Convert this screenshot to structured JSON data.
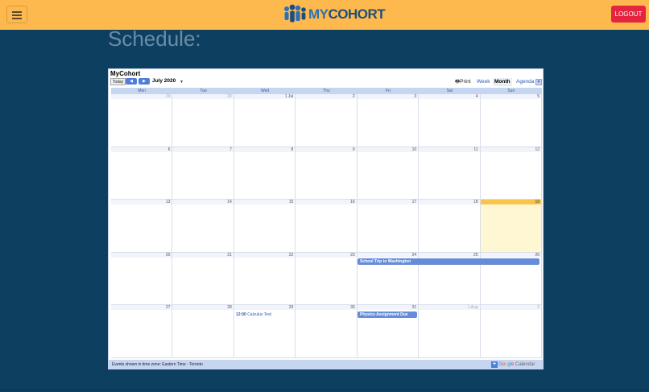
{
  "header": {
    "logo_my": "MY",
    "logo_cohort": "COHORT",
    "logout_label": "LOGOUT",
    "menu_icon": "hamburger-icon"
  },
  "page": {
    "title": "Schedule:"
  },
  "calendar": {
    "title": "MyCohort",
    "today_label": "Today",
    "prev_icon": "chevron-left-icon",
    "next_icon": "chevron-right-icon",
    "month_label": "July 2020",
    "dropdown_icon": "caret-down-icon",
    "print_label": "Print",
    "views": {
      "week": "Week",
      "month": "Month",
      "agenda": "Agenda"
    },
    "active_view": "Month",
    "weekdays": [
      "Mon",
      "Tue",
      "Wed",
      "Thu",
      "Fri",
      "Sat",
      "Sun"
    ],
    "weeks": [
      [
        "29",
        "30",
        "1 Jul",
        "2",
        "3",
        "4",
        "5"
      ],
      [
        "6",
        "7",
        "8",
        "9",
        "10",
        "11",
        "12"
      ],
      [
        "13",
        "14",
        "15",
        "16",
        "17",
        "18",
        "19"
      ],
      [
        "20",
        "21",
        "22",
        "23",
        "24",
        "25",
        "26"
      ],
      [
        "27",
        "28",
        "29",
        "30",
        "31",
        "1 Aug",
        "2"
      ]
    ],
    "today_date": "19",
    "events": {
      "school_trip": "School Trip to Washington",
      "calculus_time": "12:00",
      "calculus_title": "Calculus Test",
      "physics": "Physics Assignment Due"
    },
    "timezone_text": "Events shown in time zone: Eastern Time - Toronto",
    "google_calendar_label": "Google Calendar",
    "colors": {
      "header_bg": "#c7d6f0",
      "event_bg": "#668cd9",
      "today_bg": "#fff6d3",
      "today_header": "#f8c54a"
    }
  },
  "colors": {
    "topbar": "#fdb94e",
    "background": "#0d4060",
    "logout": "#e5243f",
    "title": "#6b8ba6"
  }
}
